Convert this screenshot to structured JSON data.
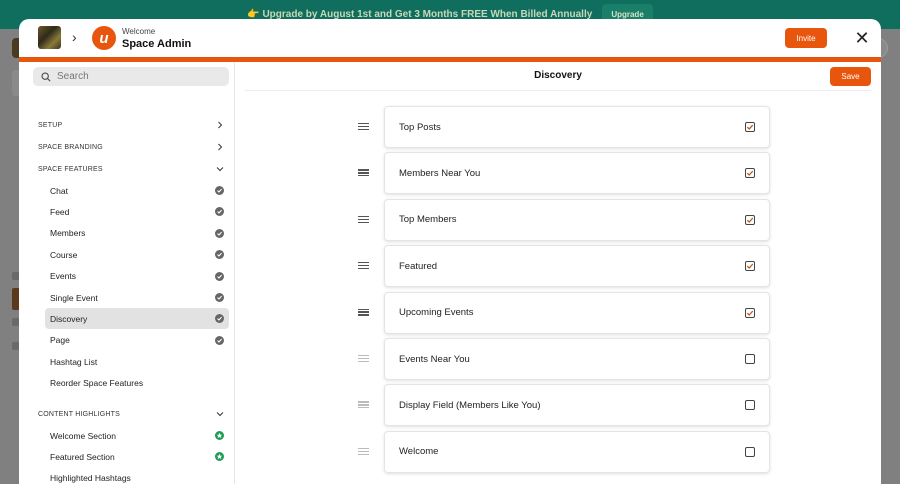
{
  "banner": {
    "text": "👉 Upgrade by August 1st and Get 3 Months FREE When Billed Annually",
    "button": "Upgrade"
  },
  "header": {
    "subtitle": "Welcome",
    "title": "Space Admin",
    "logo_letter": "u",
    "invite_label": "Invite",
    "close_glyph": "✕"
  },
  "sidebar": {
    "search_placeholder": "Search",
    "sections": [
      {
        "label": "SETUP",
        "expanded": false
      },
      {
        "label": "SPACE BRANDING",
        "expanded": false
      },
      {
        "label": "SPACE FEATURES",
        "expanded": true
      },
      {
        "label": "CONTENT HIGHLIGHTS",
        "expanded": true
      }
    ],
    "features": [
      {
        "label": "Chat",
        "status": "enabled"
      },
      {
        "label": "Feed",
        "status": "enabled"
      },
      {
        "label": "Members",
        "status": "enabled"
      },
      {
        "label": "Course",
        "status": "enabled"
      },
      {
        "label": "Events",
        "status": "enabled"
      },
      {
        "label": "Single Event",
        "status": "enabled"
      },
      {
        "label": "Discovery",
        "status": "enabled",
        "active": true
      },
      {
        "label": "Page",
        "status": "enabled"
      },
      {
        "label": "Hashtag List",
        "status": "none"
      },
      {
        "label": "Reorder Space Features",
        "status": "none"
      }
    ],
    "highlights": [
      {
        "label": "Welcome Section",
        "status": "starred"
      },
      {
        "label": "Featured Section",
        "status": "starred"
      },
      {
        "label": "Highlighted Hashtags",
        "status": "none"
      }
    ]
  },
  "main": {
    "title": "Discovery",
    "save_label": "Save",
    "items": [
      {
        "label": "Top Posts",
        "checked": true
      },
      {
        "label": "Members Near You",
        "checked": true
      },
      {
        "label": "Top Members",
        "checked": true
      },
      {
        "label": "Featured",
        "checked": true
      },
      {
        "label": "Upcoming Events",
        "checked": true
      },
      {
        "label": "Events Near You",
        "checked": false
      },
      {
        "label": "Display Field (Members Like You)",
        "checked": false
      },
      {
        "label": "Welcome",
        "checked": false
      }
    ]
  },
  "colors": {
    "accent": "#e8560e",
    "banner_bg": "#0f6e5d",
    "enabled_icon": "#666666",
    "starred_icon": "#1f9d55",
    "check_mark": "#c2531e"
  },
  "icons": {
    "search": "search-icon",
    "chevron_right": "chevron-right-icon",
    "chevron_down": "chevron-down-icon",
    "enabled": "check-circle-icon",
    "starred": "star-badge-icon",
    "drag": "drag-handle-icon",
    "checkbox": "checkbox-icon"
  }
}
